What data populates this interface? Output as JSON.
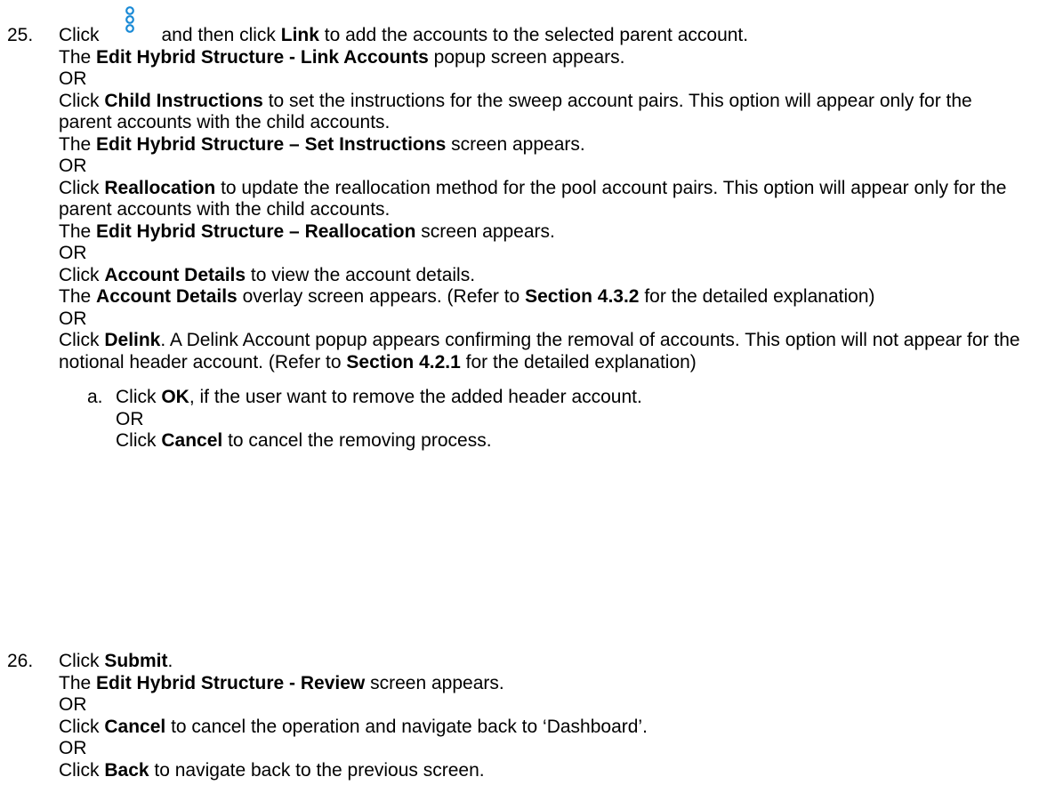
{
  "steps": [
    {
      "number": "25.",
      "lines": {
        "l1_a": "Click",
        "l1_b": "and then click",
        "l1_c": "Link",
        "l1_d": "to add the accounts to the selected parent account.",
        "l2_a": "The",
        "l2_b": "Edit Hybrid Structure - Link Accounts",
        "l2_c": "popup screen appears.",
        "or": "OR",
        "l4_a": "Click",
        "l4_b": "Child Instructions",
        "l4_c": "to set the instructions for the sweep account pairs. This option will appear only for the parent accounts with the child accounts.",
        "l6_a": "The",
        "l6_b": "Edit Hybrid Structure – Set Instructions",
        "l6_c": "screen appears.",
        "l8_a": "Click",
        "l8_b": "Reallocation",
        "l8_c": "to update the reallocation method for the pool account pairs. This option will appear only for the parent accounts with the child accounts.",
        "l10_a": "The",
        "l10_b": "Edit Hybrid Structure – Reallocation",
        "l10_c": "screen appears.",
        "l12_a": "Click",
        "l12_b": "Account Details",
        "l12_c": "to view the account details.",
        "l13_a": "The",
        "l13_b": "Account Details",
        "l13_c": "overlay screen appears. (Refer to",
        "l13_d": "Section 4.3.2",
        "l13_e": "for the detailed explanation)",
        "l16_a": "Click",
        "l16_b": "Delink",
        "l16_c": ". A Delink Account popup appears confirming the removal of accounts. This option will not appear for the notional header account. (Refer to",
        "l16_d": "Section 4.2.1",
        "l16_e": "for the detailed explanation)"
      },
      "sub": {
        "letter": "a.",
        "s1_a": "Click",
        "s1_b": "OK",
        "s1_c": ", if the user want to remove the added header account.",
        "or": "OR",
        "s3_a": "Click",
        "s3_b": "Cancel",
        "s3_c": "to cancel the removing process."
      }
    },
    {
      "number": "26.",
      "lines": {
        "l1_a": "Click",
        "l1_b": "Submit",
        "l1_c": ".",
        "l2_a": "The",
        "l2_b": "Edit Hybrid Structure - Review",
        "l2_c": "screen appears.",
        "or": "OR",
        "l4_a": "Click",
        "l4_b": "Cancel",
        "l4_c": "to cancel the operation and navigate back to ‘Dashboard’.",
        "l6_a": "Click",
        "l6_b": "Back",
        "l6_c": "to navigate back to the previous screen."
      }
    }
  ],
  "icon": {
    "name": "kebab-menu-icon",
    "color": "#1a8ad6"
  }
}
